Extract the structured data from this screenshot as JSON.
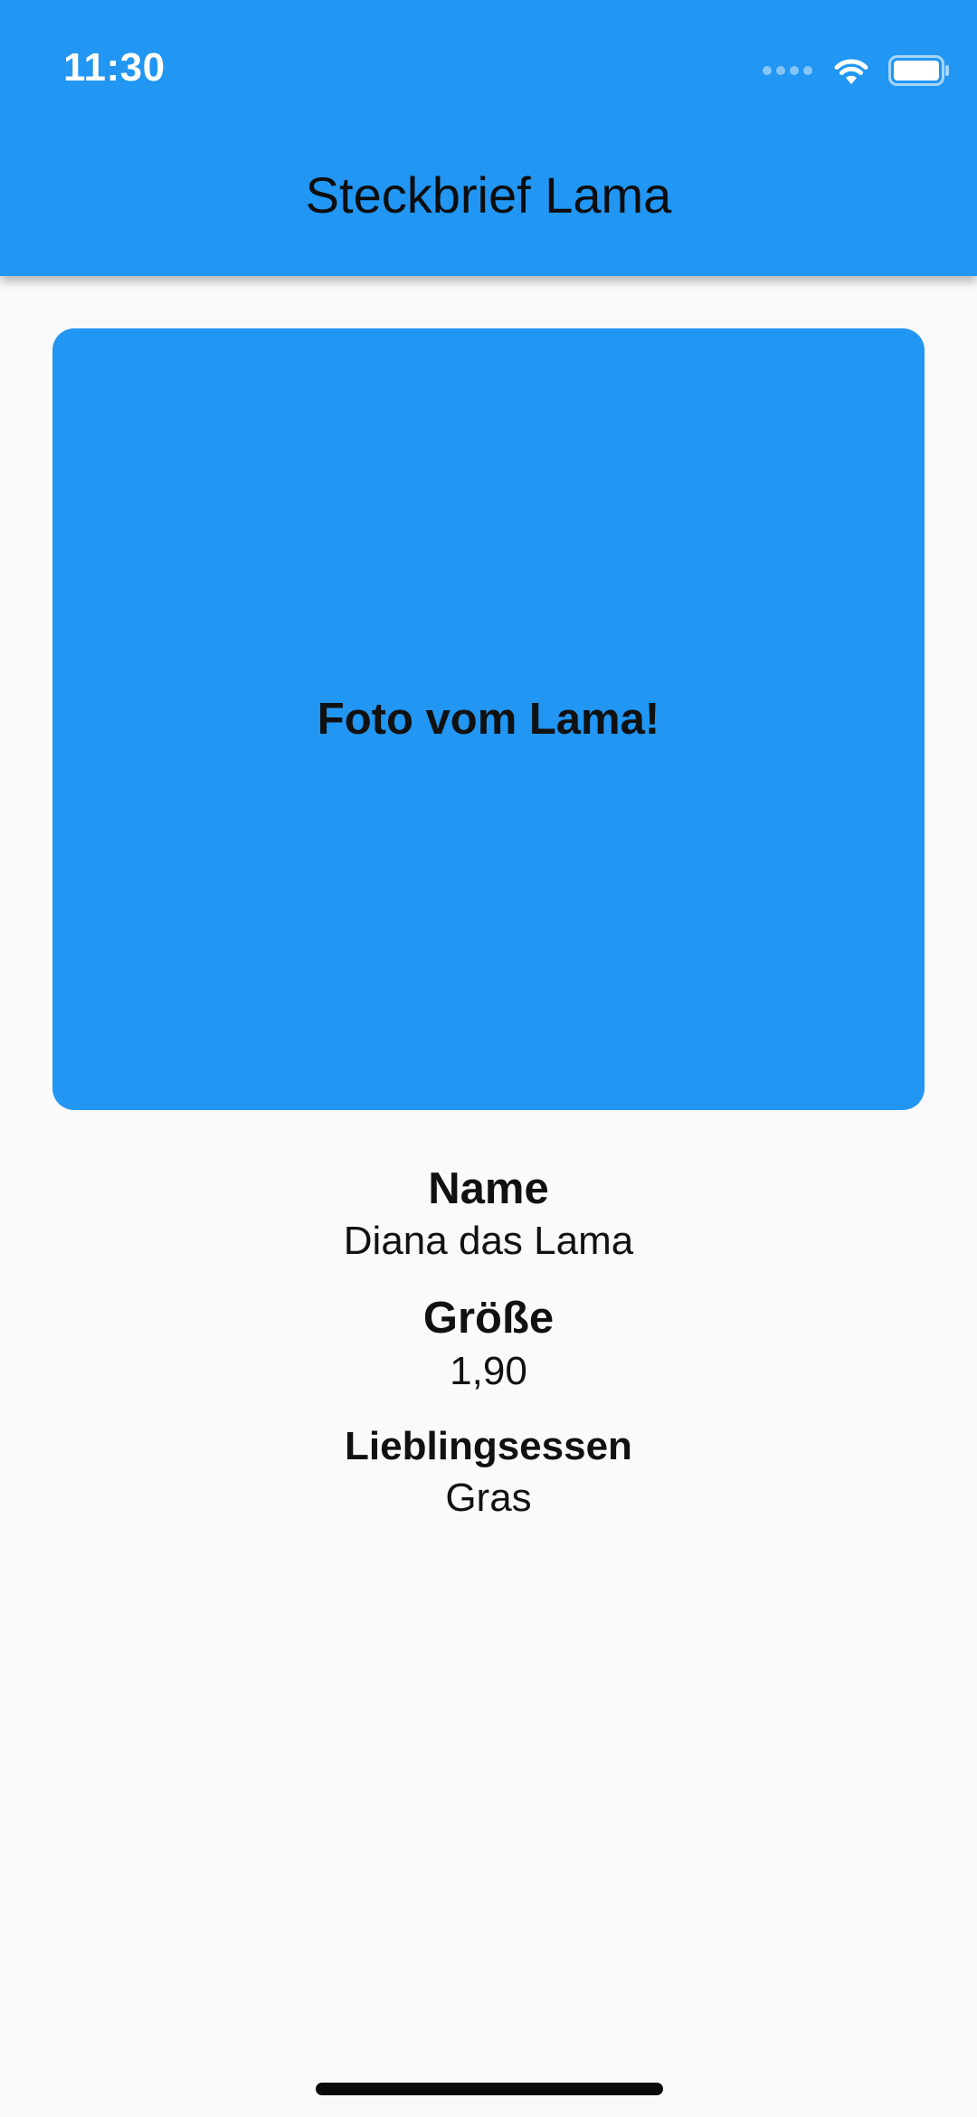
{
  "status_bar": {
    "time": "11:30",
    "icons": [
      "cellular-signal-icon",
      "wifi-icon",
      "battery-icon"
    ]
  },
  "app_bar": {
    "title": "Steckbrief Lama",
    "color": "#2196f3"
  },
  "photo": {
    "label": "Foto vom Lama!",
    "color": "#2196f3"
  },
  "profile": {
    "name_label": "Name",
    "name_value": "Diana das Lama",
    "size_label": "Größe",
    "size_value": "1,90",
    "food_label": "Lieblingsessen",
    "food_value": "Gras"
  }
}
